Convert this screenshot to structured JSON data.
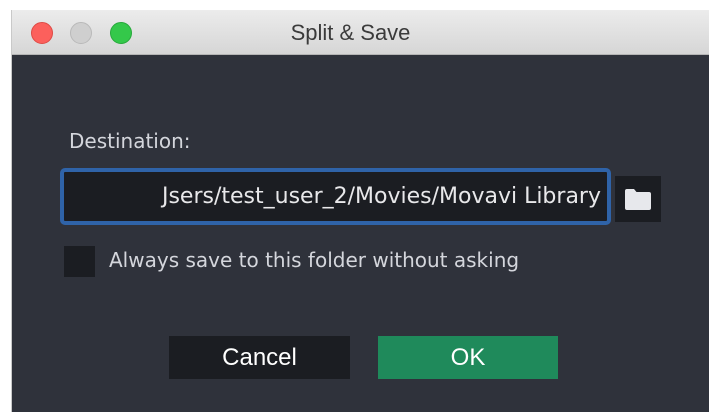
{
  "window": {
    "title": "Split & Save"
  },
  "form": {
    "destination_label": "Destination:",
    "path_value": "Jsers/test_user_2/Movies/Movavi Library",
    "browse_icon": "folder-icon",
    "always_save_label": "Always save to this folder without asking",
    "always_save_checked": false
  },
  "buttons": {
    "cancel_label": "Cancel",
    "ok_label": "OK"
  },
  "colors": {
    "accent_border": "#2f63a8",
    "ok_button": "#1f8a5b",
    "dialog_background": "#2f323b",
    "control_background": "#1b1d22"
  }
}
